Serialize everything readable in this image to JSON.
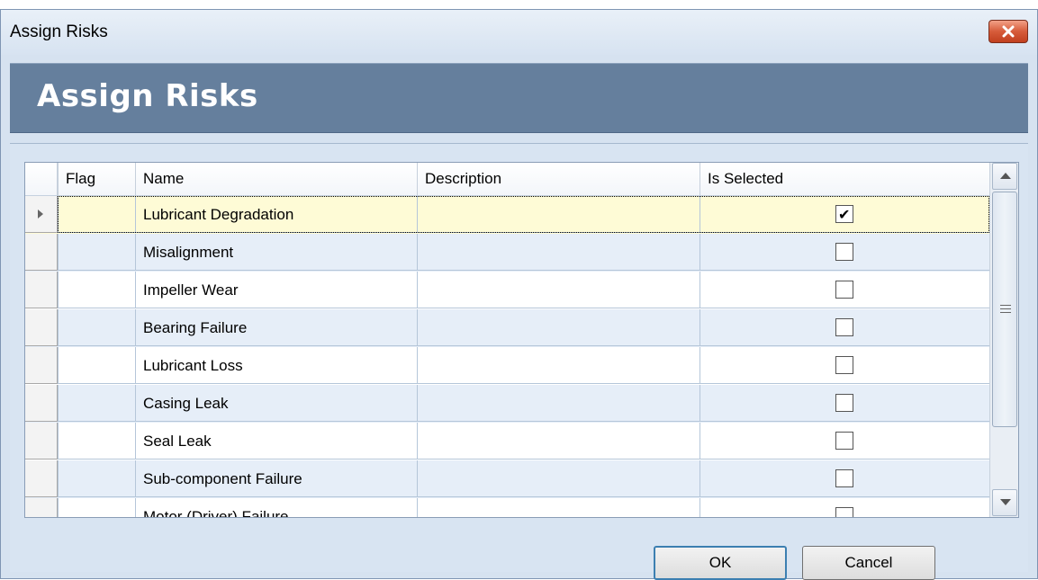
{
  "window": {
    "title": "Assign Risks"
  },
  "banner": {
    "heading": "Assign Risks"
  },
  "grid": {
    "columns": [
      "Flag",
      "Name",
      "Description",
      "Is Selected"
    ],
    "rows": [
      {
        "flag": "",
        "name": "Lubricant Degradation",
        "description": "",
        "selected": true
      },
      {
        "flag": "",
        "name": "Misalignment",
        "description": "",
        "selected": false
      },
      {
        "flag": "",
        "name": "Impeller Wear",
        "description": "",
        "selected": false
      },
      {
        "flag": "",
        "name": "Bearing Failure",
        "description": "",
        "selected": false
      },
      {
        "flag": "",
        "name": "Lubricant Loss",
        "description": "",
        "selected": false
      },
      {
        "flag": "",
        "name": "Casing Leak",
        "description": "",
        "selected": false
      },
      {
        "flag": "",
        "name": "Seal Leak",
        "description": "",
        "selected": false
      },
      {
        "flag": "",
        "name": "Sub-component Failure",
        "description": "",
        "selected": false
      },
      {
        "flag": "",
        "name": "Motor (Driver) Failure",
        "description": "",
        "selected": false
      }
    ]
  },
  "buttons": {
    "ok": "OK",
    "cancel": "Cancel"
  },
  "colors": {
    "banner": "#657f9d",
    "selected_row": "#fefbd6",
    "alt_row": "#e6eef8",
    "close_button": "#d65b3a"
  }
}
